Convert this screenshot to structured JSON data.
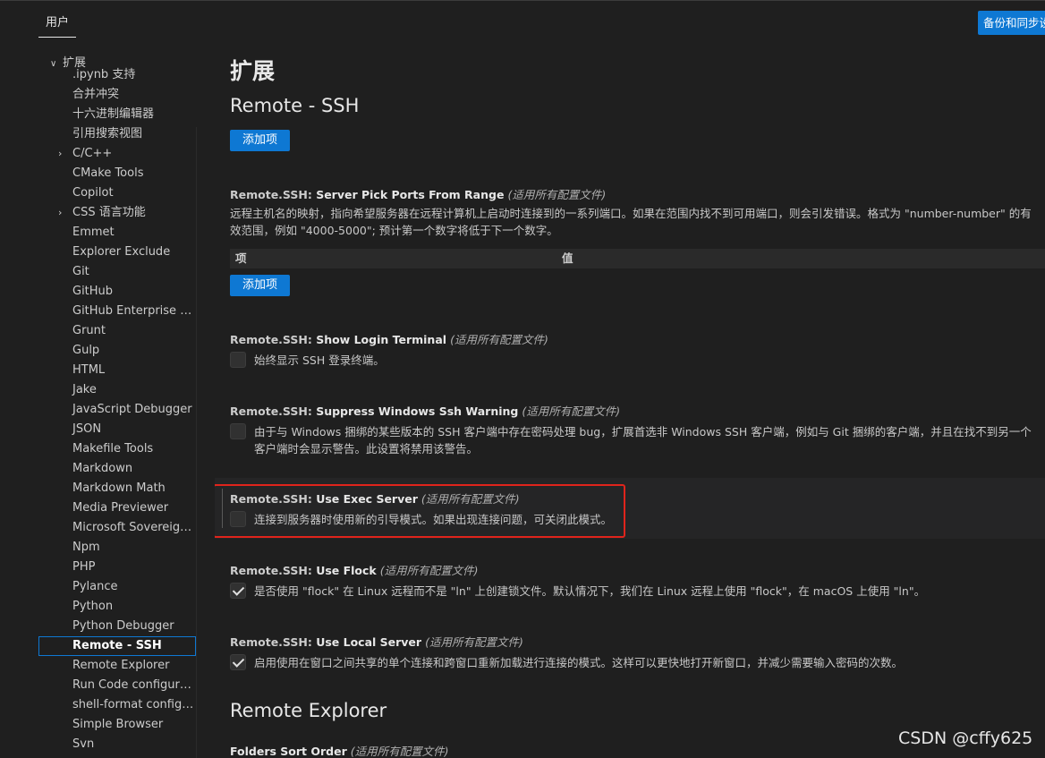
{
  "header": {
    "scope_tab": "用户",
    "sync_button": "备份和同步设置"
  },
  "sidebar": {
    "section_label": "扩展",
    "items": [
      {
        "label": ".ipynb 支持",
        "expandable": false
      },
      {
        "label": "合并冲突",
        "expandable": false
      },
      {
        "label": "十六进制编辑器",
        "expandable": false
      },
      {
        "label": "引用搜索视图",
        "expandable": false
      },
      {
        "label": "C/C++",
        "expandable": true
      },
      {
        "label": "CMake Tools",
        "expandable": false
      },
      {
        "label": "Copilot",
        "expandable": false
      },
      {
        "label": "CSS 语言功能",
        "expandable": true
      },
      {
        "label": "Emmet",
        "expandable": false
      },
      {
        "label": "Explorer Exclude",
        "expandable": false
      },
      {
        "label": "Git",
        "expandable": false
      },
      {
        "label": "GitHub",
        "expandable": false
      },
      {
        "label": "GitHub Enterprise Ser...",
        "expandable": false
      },
      {
        "label": "Grunt",
        "expandable": false
      },
      {
        "label": "Gulp",
        "expandable": false
      },
      {
        "label": "HTML",
        "expandable": false
      },
      {
        "label": "Jake",
        "expandable": false
      },
      {
        "label": "JavaScript Debugger",
        "expandable": false
      },
      {
        "label": "JSON",
        "expandable": false
      },
      {
        "label": "Makefile Tools",
        "expandable": false
      },
      {
        "label": "Markdown",
        "expandable": false
      },
      {
        "label": "Markdown Math",
        "expandable": false
      },
      {
        "label": "Media Previewer",
        "expandable": false
      },
      {
        "label": "Microsoft Sovereign C...",
        "expandable": false
      },
      {
        "label": "Npm",
        "expandable": false
      },
      {
        "label": "PHP",
        "expandable": false
      },
      {
        "label": "Pylance",
        "expandable": false
      },
      {
        "label": "Python",
        "expandable": false
      },
      {
        "label": "Python Debugger",
        "expandable": false
      },
      {
        "label": "Remote - SSH",
        "expandable": false,
        "selected": true
      },
      {
        "label": "Remote Explorer",
        "expandable": false
      },
      {
        "label": "Run Code configuration",
        "expandable": false
      },
      {
        "label": "shell-format configura...",
        "expandable": false
      },
      {
        "label": "Simple Browser",
        "expandable": false
      },
      {
        "label": "Svn",
        "expandable": false
      }
    ]
  },
  "main": {
    "category_title": "扩展",
    "section_title": "Remote - SSH",
    "add_item_label": "添加项",
    "table": {
      "col_key": "项",
      "col_value": "值"
    },
    "settings": [
      {
        "prefix": "Remote.SSH: ",
        "name": "Server Pick Ports From Range",
        "scope": "(适用所有配置文件)",
        "description": "远程主机名的映射，指向希望服务器在远程计算机上启动时连接到的一系列端口。如果在范围内找不到可用端口，则会引发错误。格式为 \"number-number\" 的有效范围，例如 \"4000-5000\"; 预计第一个数字将低于下一个数字。"
      },
      {
        "prefix": "Remote.SSH: ",
        "name": "Show Login Terminal",
        "scope": "(适用所有配置文件)",
        "description": "始终显示 SSH 登录终端。",
        "checked": false
      },
      {
        "prefix": "Remote.SSH: ",
        "name": "Suppress Windows Ssh Warning",
        "scope": "(适用所有配置文件)",
        "description": "由于与 Windows 捆绑的某些版本的 SSH 客户端中存在密码处理 bug，扩展首选非 Windows SSH 客户端，例如与 Git 捆绑的客户端，并且在找不到另一个客户端时会显示警告。此设置将禁用该警告。",
        "checked": false
      },
      {
        "prefix": "Remote.SSH: ",
        "name": "Use Exec Server",
        "scope": "(适用所有配置文件)",
        "description": "连接到服务器时使用新的引导模式。如果出现连接问题，可关闭此模式。",
        "checked": false
      },
      {
        "prefix": "Remote.SSH: ",
        "name": "Use Flock",
        "scope": "(适用所有配置文件)",
        "description": "是否使用 \"flock\" 在 Linux 远程而不是 \"ln\" 上创建锁文件。默认情况下，我们在 Linux 远程上使用 \"flock\"，在 macOS 上使用 \"ln\"。",
        "checked": true
      },
      {
        "prefix": "Remote.SSH: ",
        "name": "Use Local Server",
        "scope": "(适用所有配置文件)",
        "description": "启用使用在窗口之间共享的单个连接和跨窗口重新加载进行连接的模式。这样可以更快地打开新窗口，并减少需要输入密码的次数。",
        "checked": true
      }
    ],
    "next_section_title": "Remote Explorer",
    "next_setting": {
      "name": "Folders Sort Order",
      "scope": "(适用所有配置文件)"
    }
  },
  "watermark": "CSDN @cffy625",
  "colors": {
    "background": "#1f1f1f",
    "accent_button": "#0e78d3",
    "annotation_red": "#e0241c"
  }
}
